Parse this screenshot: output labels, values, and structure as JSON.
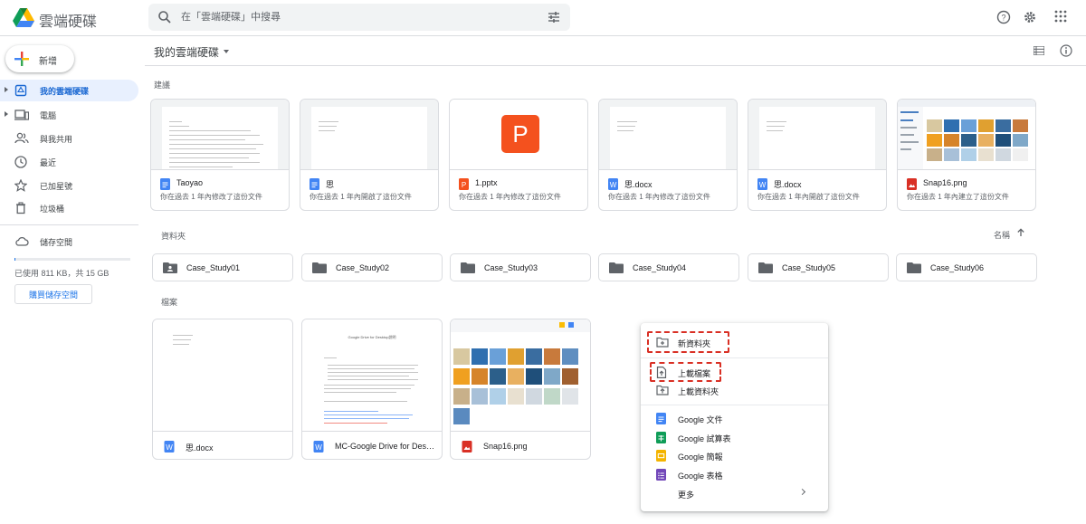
{
  "app": {
    "title": "雲端硬碟"
  },
  "search": {
    "placeholder": "在「雲端硬碟」中搜尋"
  },
  "sidebar": {
    "new_label": "新增",
    "items": [
      {
        "label": "我的雲端硬碟",
        "icon": "my-drive-icon"
      },
      {
        "label": "電腦",
        "icon": "computer-icon"
      },
      {
        "label": "與我共用",
        "icon": "shared-people-icon"
      },
      {
        "label": "最近",
        "icon": "clock-icon"
      },
      {
        "label": "已加星號",
        "icon": "star-icon"
      },
      {
        "label": "垃圾桶",
        "icon": "trash-icon"
      },
      {
        "label": "儲存空間",
        "icon": "cloud-icon"
      }
    ],
    "storage_used_text": "已使用 811 KB，共 15 GB",
    "storage_used_fraction": 5e-05,
    "buy_storage_label": "購買儲存空間"
  },
  "main": {
    "breadcrumb": "我的雲端硬碟",
    "suggested_title": "建議",
    "suggested": [
      {
        "name": "Taoyao",
        "type": "doc",
        "sub": "你在過去 1 年內修改了這份文件"
      },
      {
        "name": "思",
        "type": "doc",
        "sub": "你在過去 1 年內開啟了這份文件"
      },
      {
        "name": "1.pptx",
        "type": "ppt",
        "sub": "你在過去 1 年內修改了這份文件",
        "thumb_letter": "P"
      },
      {
        "name": "思.docx",
        "type": "word",
        "sub": "你在過去 1 年內修改了這份文件"
      },
      {
        "name": "思.docx",
        "type": "word",
        "sub": "你在過去 1 年內開啟了這份文件"
      },
      {
        "name": "Snap16.png",
        "type": "image",
        "sub": "你在過去 1 年內建立了這份文件"
      }
    ],
    "folders_title": "資料夾",
    "sort_label": "名稱",
    "folders": [
      {
        "name": "Case_Study01",
        "shared": true
      },
      {
        "name": "Case_Study02"
      },
      {
        "name": "Case_Study03"
      },
      {
        "name": "Case_Study04"
      },
      {
        "name": "Case_Study05"
      },
      {
        "name": "Case_Study06"
      }
    ],
    "files_title": "檔案",
    "files": [
      {
        "name": "思.docx",
        "type": "word"
      },
      {
        "name": "MC-Google Drive for Deskt...",
        "type": "word",
        "thumb_title": "Google Drive for Desktop說明"
      },
      {
        "name": "Snap16.png",
        "type": "image"
      }
    ]
  },
  "context_menu": {
    "items": [
      {
        "label": "新資料夾",
        "icon": "new-folder-icon",
        "highlighted": true
      },
      {
        "label": "上載檔案",
        "icon": "file-upload-icon",
        "highlighted": true
      },
      {
        "label": "上載資料夾",
        "icon": "folder-upload-icon"
      },
      {
        "label": "Google 文件",
        "icon": "google-docs-icon"
      },
      {
        "label": "Google 試算表",
        "icon": "google-sheets-icon"
      },
      {
        "label": "Google 簡報",
        "icon": "google-slides-icon"
      },
      {
        "label": "Google 表格",
        "icon": "google-forms-icon"
      },
      {
        "label": "更多",
        "icon": "chevron-right-icon"
      }
    ]
  },
  "colors": {
    "accent": "#1a73e8",
    "active_bg": "#e8f0fe",
    "highlight": "#d93025"
  }
}
